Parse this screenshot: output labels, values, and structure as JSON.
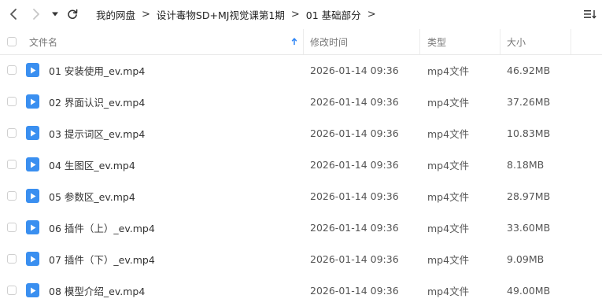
{
  "breadcrumb": [
    "我的网盘",
    "设计毒物SD+MJ视觉课第1期",
    "01 基础部分"
  ],
  "columns": {
    "name": "文件名",
    "modified": "修改时间",
    "type": "类型",
    "size": "大小"
  },
  "files": [
    {
      "name": "01 安装使用_ev.mp4",
      "modified": "2026-01-14 09:36",
      "type": "mp4文件",
      "size": "46.92MB"
    },
    {
      "name": "02 界面认识_ev.mp4",
      "modified": "2026-01-14 09:36",
      "type": "mp4文件",
      "size": "37.26MB"
    },
    {
      "name": "03 提示词区_ev.mp4",
      "modified": "2026-01-14 09:36",
      "type": "mp4文件",
      "size": "10.83MB"
    },
    {
      "name": "04 生图区_ev.mp4",
      "modified": "2026-01-14 09:36",
      "type": "mp4文件",
      "size": "8.18MB"
    },
    {
      "name": "05 参数区_ev.mp4",
      "modified": "2026-01-14 09:36",
      "type": "mp4文件",
      "size": "28.97MB"
    },
    {
      "name": "06 插件（上）_ev.mp4",
      "modified": "2026-01-14 09:36",
      "type": "mp4文件",
      "size": "33.60MB"
    },
    {
      "name": "07 插件（下）_ev.mp4",
      "modified": "2026-01-14 09:36",
      "type": "mp4文件",
      "size": "9.09MB"
    },
    {
      "name": "08 模型介绍_ev.mp4",
      "modified": "2026-01-14 09:36",
      "type": "mp4文件",
      "size": "49.00MB"
    }
  ],
  "icons": {
    "back": "chevron-left-icon",
    "forward": "chevron-right-icon",
    "history": "caret-down-icon",
    "refresh": "refresh-icon",
    "sort": "sort-ascending-icon",
    "view": "list-view-icon",
    "file": "video-file-icon"
  },
  "colors": {
    "accent": "#3a8ff0",
    "sort_arrow": "#2f86f6",
    "disabled_icon": "#c6c6c6"
  }
}
